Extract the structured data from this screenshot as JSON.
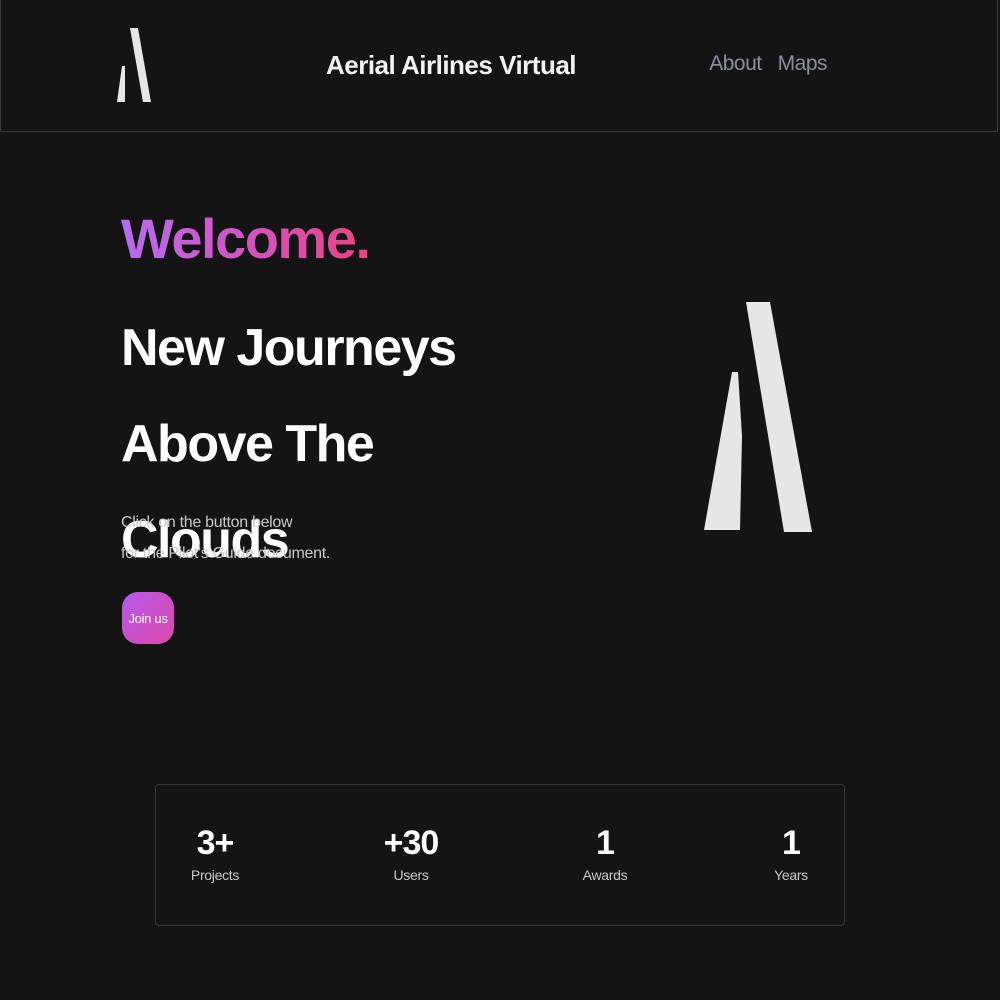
{
  "header": {
    "title": "Aerial Airlines Virtual",
    "logo_icon": "aerial-logo-icon",
    "nav": [
      {
        "label": "About"
      },
      {
        "label": "Maps"
      }
    ]
  },
  "hero": {
    "welcome": "Welcome.",
    "headline_line1": "New Journeys Above The",
    "headline_line2": "Clouds",
    "subtext_line1": "Click on the button below",
    "subtext_line2": "for the Pilot's Guide document.",
    "button_label": "Join us"
  },
  "stats": [
    {
      "value": "3+",
      "label": "Projects"
    },
    {
      "value": "+30",
      "label": "Users"
    },
    {
      "value": "1",
      "label": "Awards"
    },
    {
      "value": "1",
      "label": "Years"
    }
  ],
  "colors": {
    "background": "#141414",
    "accent_start": "#b56cf0",
    "accent_end": "#e8457f",
    "nav_text": "#8a8f9c",
    "logo": "#e6e6e6"
  }
}
